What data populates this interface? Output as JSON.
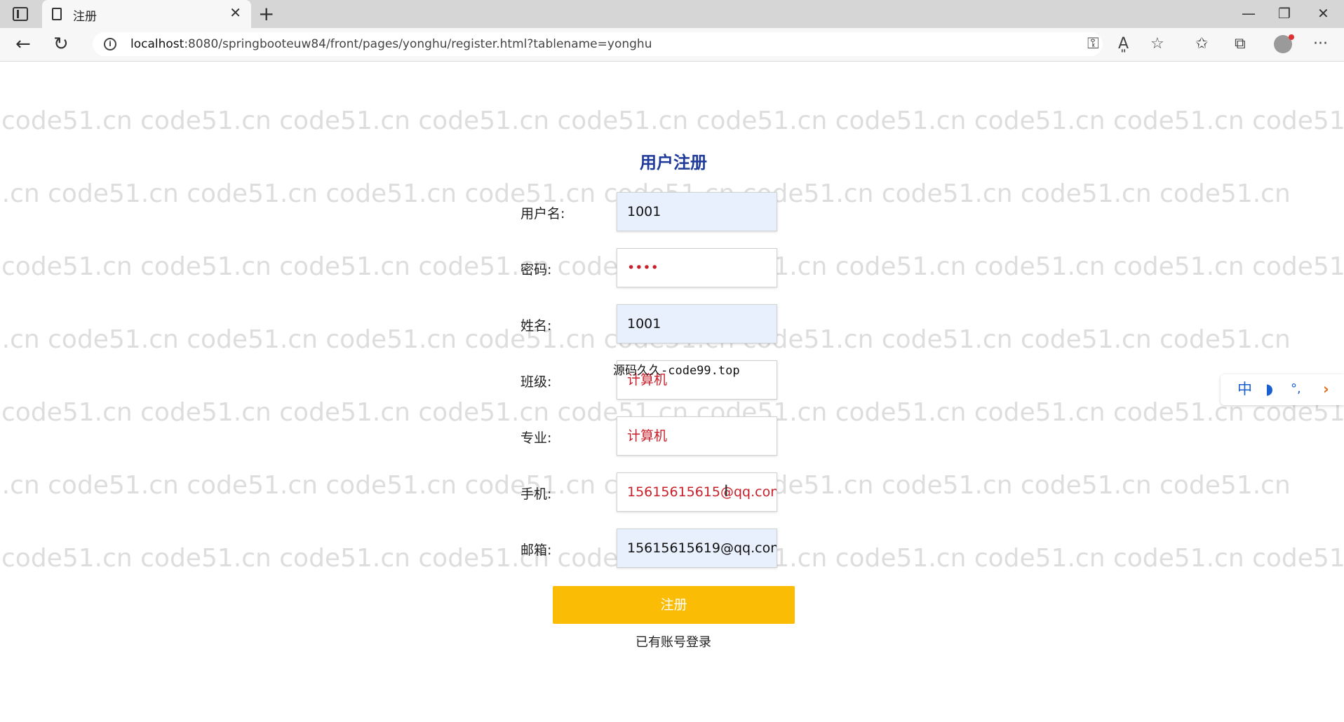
{
  "browser": {
    "tab_title": "注册",
    "url_host": "localhost",
    "url_rest": ":8080/springbooteuw84/front/pages/yonghu/register.html?tablename=yonghu",
    "icons": [
      "sidebar-toggle-icon",
      "page-icon",
      "close-icon",
      "plus-icon",
      "minimize-icon",
      "restore-icon",
      "window-close-icon",
      "back-icon",
      "reload-icon",
      "info-icon",
      "key-icon",
      "read-aloud-icon",
      "add-favorite-icon",
      "favorites-icon",
      "collections-icon",
      "profile-avatar",
      "more-icon"
    ]
  },
  "watermark": "code51.cn",
  "overlay_watermark": "源码久久-code99.top",
  "form": {
    "title": "用户注册",
    "fields": [
      {
        "label": "用户名:",
        "value": "1001",
        "style": "autofill"
      },
      {
        "label": "密码:",
        "value": "••••",
        "style": "plain"
      },
      {
        "label": "姓名:",
        "value": "1001",
        "style": "autofill"
      },
      {
        "label": "班级:",
        "value": "计算机",
        "style": "plain"
      },
      {
        "label": "专业:",
        "value": "计算机",
        "style": "plain"
      },
      {
        "label": "手机:",
        "value": "15615615615@qq.con",
        "style": "plain"
      },
      {
        "label": "邮箱:",
        "value": "15615615619@qq.con",
        "style": "autofill"
      }
    ],
    "submit_label": "注册",
    "login_link": "已有账号登录"
  },
  "ime": {
    "mode": "中",
    "moon": "◗",
    "punct": "°,",
    "arrow": "›"
  },
  "colors": {
    "accent_button": "#fbbc05",
    "title_color": "#1e3a9a",
    "autofill_bg": "#e8f0fe",
    "input_text_red": "#c8202a"
  }
}
